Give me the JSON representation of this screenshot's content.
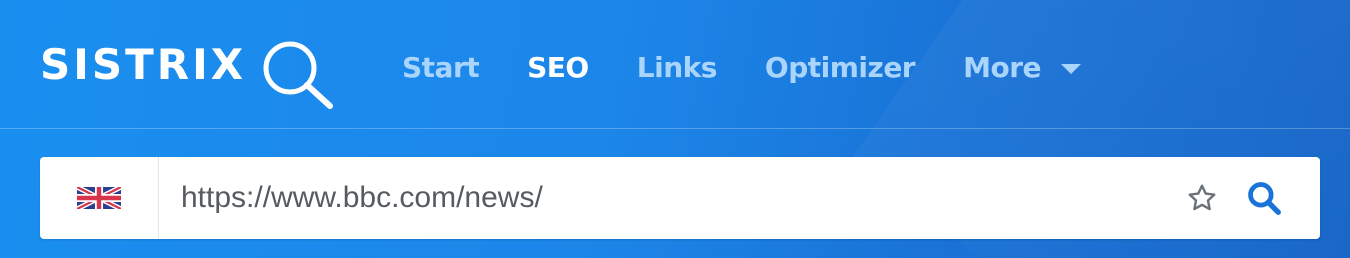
{
  "brand": {
    "name": "SISTRIX",
    "logo_icon": "magnifier-icon"
  },
  "nav": {
    "items": [
      {
        "label": "Start",
        "active": false
      },
      {
        "label": "SEO",
        "active": true
      },
      {
        "label": "Links",
        "active": false
      },
      {
        "label": "Optimizer",
        "active": false
      },
      {
        "label": "More",
        "active": false,
        "has_dropdown": true
      }
    ]
  },
  "search": {
    "country_icon": "uk-flag-icon",
    "value": "https://www.bbc.com/news/",
    "favorite_icon": "star-icon",
    "submit_icon": "search-icon"
  },
  "colors": {
    "header_bg": "#1a8ff0",
    "nav_active": "#ffffff",
    "nav_inactive": "#a9d4fb",
    "search_icon": "#1b73d9",
    "star_icon": "#6b7178"
  }
}
